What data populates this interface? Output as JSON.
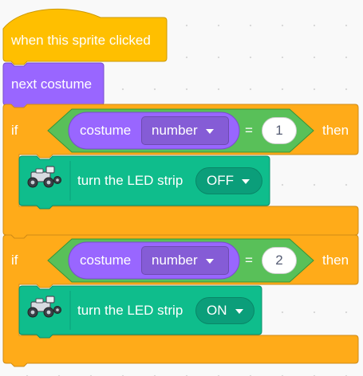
{
  "colors": {
    "events": "#ffbf00",
    "looks": "#9966ff",
    "control": "#ffab19",
    "operators": "#59c059",
    "extension": "#0fbd8c",
    "text_on_block": "#ffffff",
    "number_text": "#575e75"
  },
  "hat_block": {
    "label": "when this sprite clicked"
  },
  "next_costume_block": {
    "label": "next costume"
  },
  "if_blocks": [
    {
      "keyword": "if",
      "then_label": "then",
      "condition": {
        "reporter_label": "costume",
        "reporter_dropdown": "number",
        "operator": "=",
        "value": "1"
      },
      "action": {
        "label": "turn the LED strip",
        "menu_value": "OFF",
        "icon": "robot-car-icon"
      }
    },
    {
      "keyword": "if",
      "then_label": "then",
      "condition": {
        "reporter_label": "costume",
        "reporter_dropdown": "number",
        "operator": "=",
        "value": "2"
      },
      "action": {
        "label": "turn the LED strip",
        "menu_value": "ON",
        "icon": "robot-car-icon"
      }
    }
  ]
}
